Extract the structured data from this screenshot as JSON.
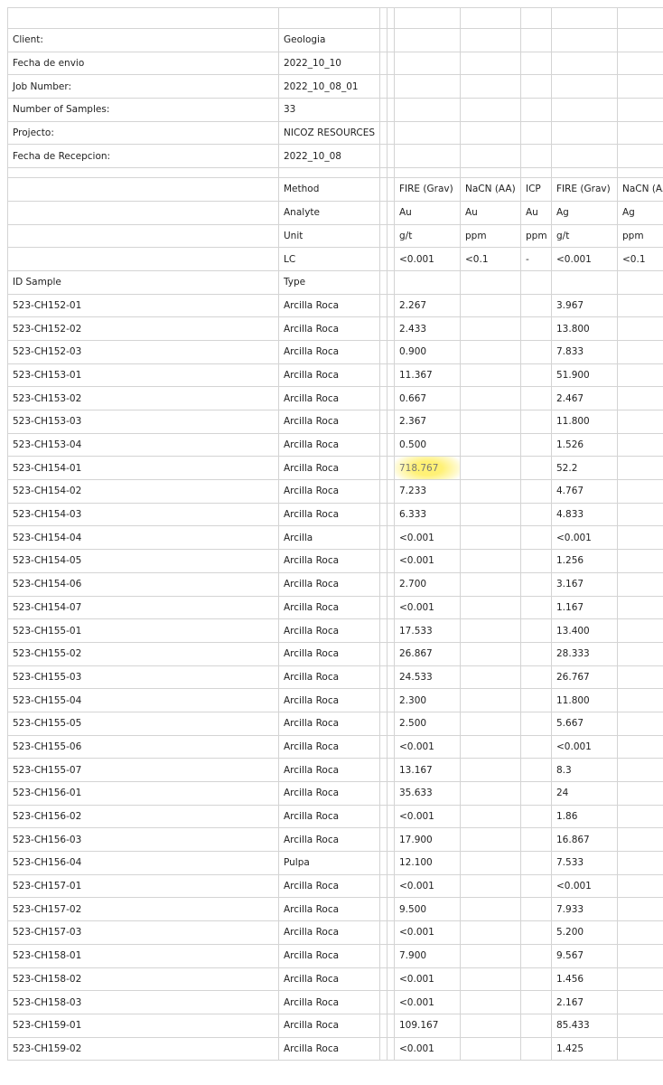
{
  "header": [
    {
      "label": "Client:",
      "value": "Geologia"
    },
    {
      "label": "Fecha de envio",
      "value": "2022_10_10"
    },
    {
      "label": "Job Number:",
      "value": "2022_10_08_01"
    },
    {
      "label": "Number of Samples:",
      "value": "33"
    },
    {
      "label": "Projecto:",
      "value": "NICOZ RESOURCES"
    },
    {
      "label": "Fecha de Recepcion:",
      "value": "2022_10_08"
    }
  ],
  "method_header": {
    "rows": [
      {
        "label": "Method",
        "cols": [
          "FIRE (Grav)",
          "NaCN (AA)",
          "ICP",
          "FIRE (Grav)",
          "NaCN (AA"
        ]
      },
      {
        "label": "Analyte",
        "cols": [
          "Au",
          "Au",
          "Au",
          "Ag",
          "Ag"
        ]
      },
      {
        "label": "Unit",
        "cols": [
          "g/t",
          "ppm",
          "ppm",
          "g/t",
          "ppm"
        ]
      },
      {
        "label": "LC",
        "cols": [
          "<0.001",
          "<0.1",
          "-",
          "<0.001",
          "<0.1"
        ]
      }
    ]
  },
  "columns": {
    "id": "ID Sample",
    "type": "Type"
  },
  "highlight_color": "#fff06e",
  "samples": [
    {
      "id": "523-CH152-01",
      "type": "Arcilla Roca",
      "au": "2.267",
      "ag": "3.967"
    },
    {
      "id": "523-CH152-02",
      "type": "Arcilla Roca",
      "au": "2.433",
      "ag": "13.800"
    },
    {
      "id": "523-CH152-03",
      "type": "Arcilla Roca",
      "au": "0.900",
      "ag": "7.833"
    },
    {
      "id": "523-CH153-01",
      "type": "Arcilla Roca",
      "au": "11.367",
      "ag": "51.900"
    },
    {
      "id": "523-CH153-02",
      "type": "Arcilla Roca",
      "au": "0.667",
      "ag": "2.467"
    },
    {
      "id": "523-CH153-03",
      "type": "Arcilla Roca",
      "au": "2.367",
      "ag": "11.800"
    },
    {
      "id": "523-CH153-04",
      "type": "Arcilla Roca",
      "au": "0.500",
      "ag": "1.526"
    },
    {
      "id": "523-CH154-01",
      "type": "Arcilla Roca",
      "au": "718.767",
      "ag": "52.2",
      "highlight": true
    },
    {
      "id": "523-CH154-02",
      "type": "Arcilla Roca",
      "au": "7.233",
      "ag": "4.767"
    },
    {
      "id": "523-CH154-03",
      "type": "Arcilla Roca",
      "au": "6.333",
      "ag": "4.833"
    },
    {
      "id": "523-CH154-04",
      "type": "Arcilla",
      "au": "<0.001",
      "ag": "<0.001"
    },
    {
      "id": "523-CH154-05",
      "type": "Arcilla Roca",
      "au": "<0.001",
      "ag": "1.256"
    },
    {
      "id": "523-CH154-06",
      "type": "Arcilla Roca",
      "au": "2.700",
      "ag": "3.167"
    },
    {
      "id": "523-CH154-07",
      "type": "Arcilla Roca",
      "au": "<0.001",
      "ag": "1.167"
    },
    {
      "id": "523-CH155-01",
      "type": "Arcilla Roca",
      "au": "17.533",
      "ag": "13.400"
    },
    {
      "id": "523-CH155-02",
      "type": "Arcilla Roca",
      "au": "26.867",
      "ag": "28.333"
    },
    {
      "id": "523-CH155-03",
      "type": "Arcilla Roca",
      "au": "24.533",
      "ag": "26.767"
    },
    {
      "id": "523-CH155-04",
      "type": "Arcilla Roca",
      "au": "2.300",
      "ag": "11.800"
    },
    {
      "id": "523-CH155-05",
      "type": "Arcilla Roca",
      "au": "2.500",
      "ag": "5.667"
    },
    {
      "id": "523-CH155-06",
      "type": "Arcilla Roca",
      "au": "<0.001",
      "ag": "<0.001"
    },
    {
      "id": "523-CH155-07",
      "type": "Arcilla Roca",
      "au": "13.167",
      "ag": "8.3"
    },
    {
      "id": "523-CH156-01",
      "type": "Arcilla Roca",
      "au": "35.633",
      "ag": "24"
    },
    {
      "id": "523-CH156-02",
      "type": "Arcilla Roca",
      "au": "<0.001",
      "ag": "1.86"
    },
    {
      "id": "523-CH156-03",
      "type": "Arcilla Roca",
      "au": "17.900",
      "ag": "16.867"
    },
    {
      "id": "523-CH156-04",
      "type": "Pulpa",
      "au": "12.100",
      "ag": "7.533"
    },
    {
      "id": "523-CH157-01",
      "type": "Arcilla Roca",
      "au": "<0.001",
      "ag": "<0.001"
    },
    {
      "id": "523-CH157-02",
      "type": "Arcilla Roca",
      "au": "9.500",
      "ag": "7.933"
    },
    {
      "id": "523-CH157-03",
      "type": "Arcilla Roca",
      "au": "<0.001",
      "ag": "5.200"
    },
    {
      "id": "523-CH158-01",
      "type": "Arcilla Roca",
      "au": "7.900",
      "ag": "9.567"
    },
    {
      "id": "523-CH158-02",
      "type": "Arcilla Roca",
      "au": "<0.001",
      "ag": "1.456"
    },
    {
      "id": "523-CH158-03",
      "type": "Arcilla Roca",
      "au": "<0.001",
      "ag": "2.167"
    },
    {
      "id": "523-CH159-01",
      "type": "Arcilla Roca",
      "au": "109.167",
      "ag": "85.433"
    },
    {
      "id": "523-CH159-02",
      "type": "Arcilla Roca",
      "au": "<0.001",
      "ag": "1.425"
    }
  ]
}
